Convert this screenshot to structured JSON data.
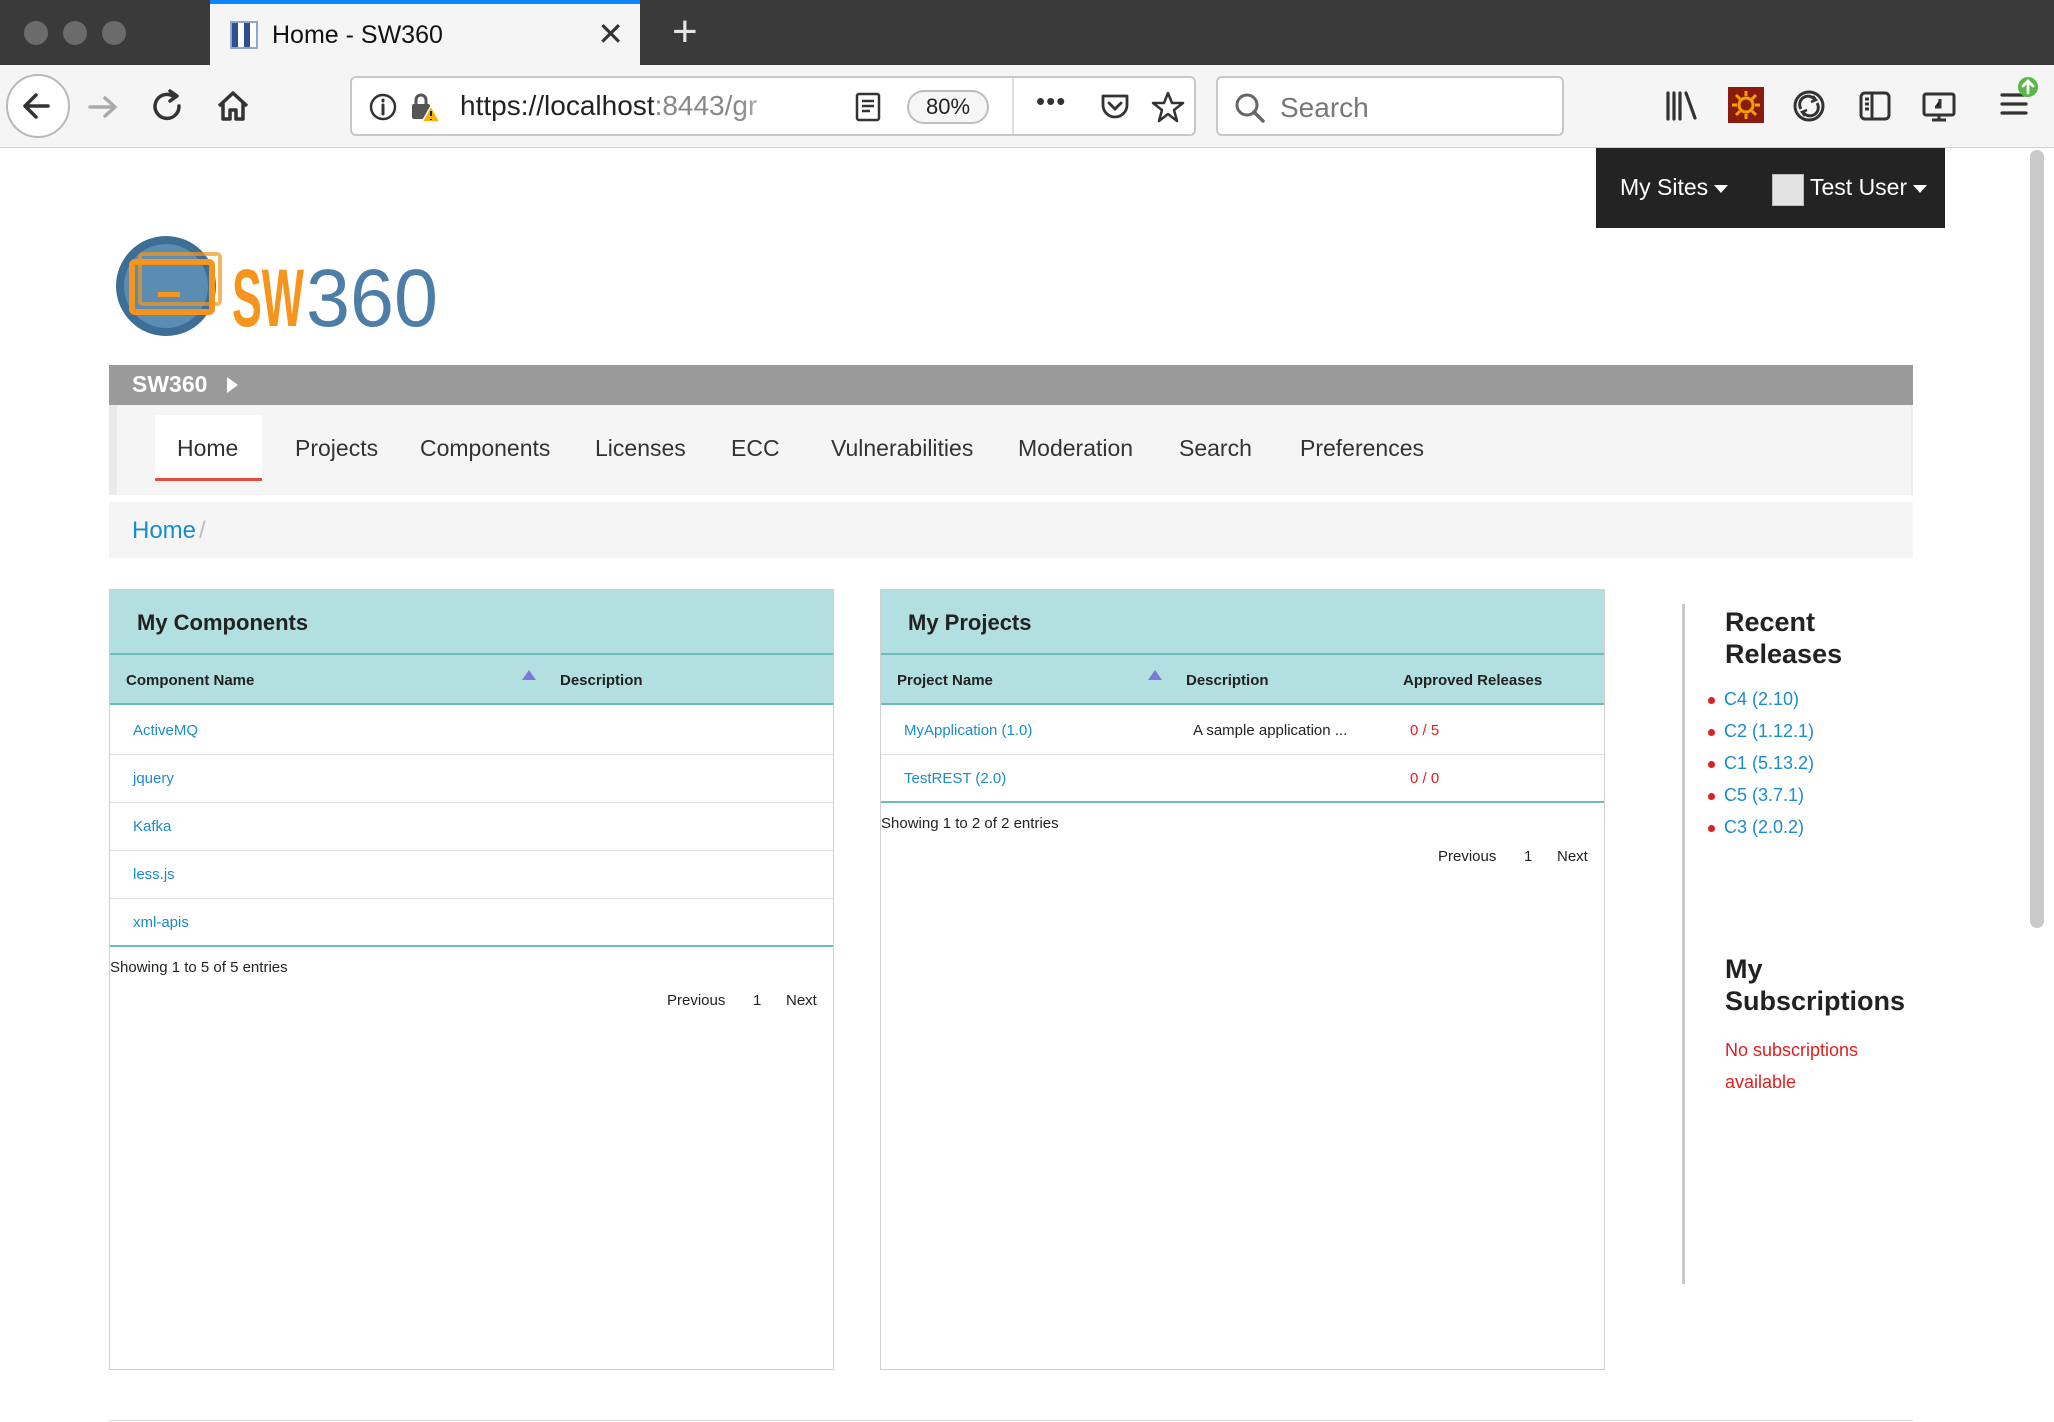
{
  "browser": {
    "tab_title": "Home - SW360",
    "tab_close": "✕",
    "new_tab": "+",
    "url_host": "https://localhost",
    "url_rest": ":8443/gr",
    "zoom": "80%",
    "more": "•••",
    "search_placeholder": "Search",
    "icons": [
      "back-arrow-icon",
      "forward-arrow-icon",
      "reload-icon",
      "home-icon",
      "info-icon",
      "lock-warning-icon",
      "reader-view-icon",
      "pocket-icon",
      "star-icon",
      "search-icon",
      "library-icon",
      "extension-icon",
      "sync-icon",
      "sidebar-icon",
      "screenshot-icon",
      "menu-icon"
    ]
  },
  "top_menu": {
    "my_sites": "My Sites",
    "user": "Test User"
  },
  "site_bar": {
    "title": "SW360"
  },
  "nav": {
    "items": [
      "Home",
      "Projects",
      "Components",
      "Licenses",
      "ECC",
      "Vulnerabilities",
      "Moderation",
      "Search",
      "Preferences"
    ],
    "active": "Home"
  },
  "breadcrumb": {
    "home": "Home",
    "sep": "/"
  },
  "my_components": {
    "title": "My Components",
    "columns": [
      "Component Name",
      "Description"
    ],
    "rows": [
      {
        "name": "ActiveMQ"
      },
      {
        "name": "jquery"
      },
      {
        "name": "Kafka"
      },
      {
        "name": "less.js"
      },
      {
        "name": "xml-apis"
      }
    ],
    "info": "Showing 1 to 5 of 5 entries",
    "pager": {
      "prev": "Previous",
      "page": "1",
      "next": "Next"
    }
  },
  "my_projects": {
    "title": "My Projects",
    "columns": [
      "Project Name",
      "Description",
      "Approved Releases"
    ],
    "rows": [
      {
        "name": "MyApplication (1.0)",
        "description": "A sample application ...",
        "approved": "0 / 5"
      },
      {
        "name": "TestREST (2.0)",
        "description": "",
        "approved": "0 / 0"
      }
    ],
    "info": "Showing 1 to 2 of 2 entries",
    "pager": {
      "prev": "Previous",
      "page": "1",
      "next": "Next"
    }
  },
  "recent_releases": {
    "title_line1": "Recent",
    "title_line2": "Releases",
    "items": [
      "C4 (2.10)",
      "C2 (1.12.1)",
      "C1 (5.13.2)",
      "C5 (3.7.1)",
      "C3 (2.0.2)"
    ]
  },
  "subscriptions": {
    "title_line1": "My",
    "title_line2": "Subscriptions",
    "empty_message": "No subscriptions available"
  },
  "logo_text": "SW360",
  "colors": {
    "accent_blue": "#0a84ff",
    "link": "#1a8ccb",
    "panel_head": "#b2dfdf",
    "active_underline": "#e74c3c",
    "warning_red": "#e02020"
  }
}
